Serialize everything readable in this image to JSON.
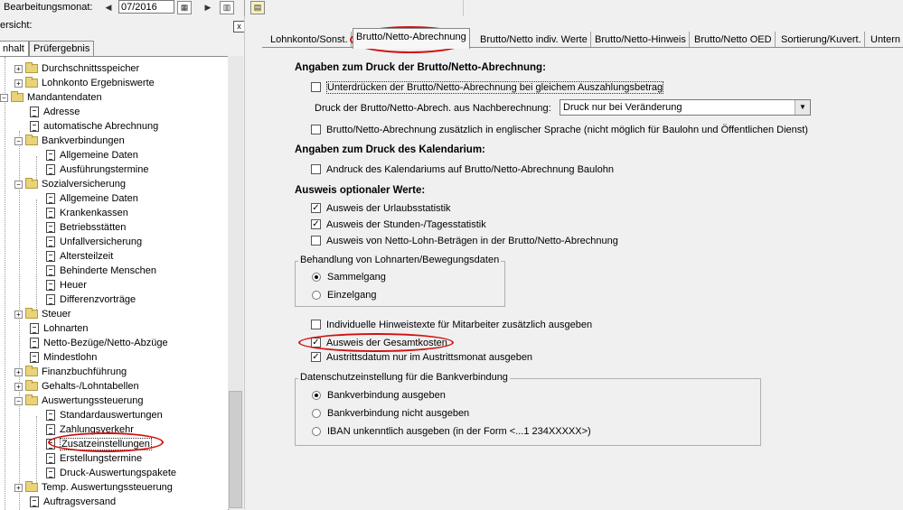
{
  "toolbar": {
    "label": "Bearbeitungsmonat:",
    "month": "07/2016"
  },
  "left_panel": {
    "header": "ersicht:",
    "close": "x",
    "tabs": [
      "nhalt",
      "Prüfergebnis"
    ],
    "tree": [
      {
        "label": "Durchschnittsspeicher",
        "type": "folder",
        "level": 1,
        "expander": "+"
      },
      {
        "label": "Lohnkonto Ergebniswerte",
        "type": "folder",
        "level": 1,
        "expander": "+"
      },
      {
        "label": "Mandantendaten",
        "type": "folder-open",
        "level": 0,
        "expander": "-"
      },
      {
        "label": "Adresse",
        "type": "doc",
        "level": 1
      },
      {
        "label": "automatische Abrechnung",
        "type": "doc",
        "level": 1
      },
      {
        "label": "Bankverbindungen",
        "type": "folder-open",
        "level": 1,
        "expander": "-"
      },
      {
        "label": "Allgemeine Daten",
        "type": "doc",
        "level": 2
      },
      {
        "label": "Ausführungstermine",
        "type": "doc",
        "level": 2
      },
      {
        "label": "Sozialversicherung",
        "type": "folder-open",
        "level": 1,
        "expander": "-"
      },
      {
        "label": "Allgemeine Daten",
        "type": "doc",
        "level": 2
      },
      {
        "label": "Krankenkassen",
        "type": "doc",
        "level": 2
      },
      {
        "label": "Betriebsstätten",
        "type": "doc",
        "level": 2
      },
      {
        "label": "Unfallversicherung",
        "type": "doc",
        "level": 2
      },
      {
        "label": "Altersteilzeit",
        "type": "doc",
        "level": 2
      },
      {
        "label": "Behinderte Menschen",
        "type": "doc",
        "level": 2
      },
      {
        "label": "Heuer",
        "type": "doc",
        "level": 2
      },
      {
        "label": "Differenzvorträge",
        "type": "doc",
        "level": 2
      },
      {
        "label": "Steuer",
        "type": "folder",
        "level": 1,
        "expander": "+"
      },
      {
        "label": "Lohnarten",
        "type": "doc",
        "level": 1
      },
      {
        "label": "Netto-Bezüge/Netto-Abzüge",
        "type": "doc",
        "level": 1
      },
      {
        "label": "Mindestlohn",
        "type": "doc",
        "level": 1
      },
      {
        "label": "Finanzbuchführung",
        "type": "folder",
        "level": 1,
        "expander": "+"
      },
      {
        "label": "Gehalts-/Lohntabellen",
        "type": "folder",
        "level": 1,
        "expander": "+"
      },
      {
        "label": "Auswertungssteuerung",
        "type": "folder-open",
        "level": 1,
        "expander": "-"
      },
      {
        "label": "Standardauswertungen",
        "type": "doc",
        "level": 2
      },
      {
        "label": "Zahlungsverkehr",
        "type": "doc",
        "level": 2
      },
      {
        "label": "Zusatzeinstellungen",
        "type": "doc",
        "level": 2
      },
      {
        "label": "Erstellungstermine",
        "type": "doc",
        "level": 2
      },
      {
        "label": "Druck-Auswertungspakete",
        "type": "doc",
        "level": 2
      },
      {
        "label": "Temp. Auswertungssteuerung",
        "type": "folder",
        "level": 1,
        "expander": "+"
      },
      {
        "label": "Auftragsversand",
        "type": "doc",
        "level": 1
      }
    ]
  },
  "tabs": [
    "Lohnkonto/Sonst.",
    "Brutto/Netto-Abrechnung",
    "Brutto/Netto indiv. Werte",
    "Brutto/Netto-Hinweis",
    "Brutto/Netto OED",
    "Sortierung/Kuvert.",
    "Untern"
  ],
  "form": {
    "sec1_title": "Angaben zum Druck der Brutto/Netto-Abrechnung:",
    "cb_unterdruecken": "Unterdrücken der Brutto/Netto-Abrechnung bei gleichem Auszahlungsbetrag",
    "nachberechnung_label": "Druck der Brutto/Netto-Abrech. aus Nachberechnung:",
    "nachberechnung_value": "Druck nur bei Veränderung",
    "cb_englisch": "Brutto/Netto-Abrechnung zusätzlich in englischer Sprache (nicht möglich für Baulohn und Öffentlichen Dienst)",
    "sec2_title": "Angaben zum Druck des Kalendarium:",
    "cb_kalendarium": "Andruck des Kalendariums auf Brutto/Netto-Abrechnung Baulohn",
    "sec3_title": "Ausweis optionaler Werte:",
    "cb_urlaub": "Ausweis der Urlaubsstatistik",
    "cb_stunden": "Ausweis der Stunden-/Tagesstatistik",
    "cb_netto_lohn": "Ausweis von Netto-Lohn-Beträgen in der Brutto/Netto-Abrechnung",
    "grp_lohnarten_title": "Behandlung von Lohnarten/Bewegungsdaten",
    "rb_sammelgang": "Sammelgang",
    "rb_einzelgang": "Einzelgang",
    "cb_hinweistexte": "Individuelle Hinweistexte für Mitarbeiter zusätzlich ausgeben",
    "cb_gesamtkosten": "Ausweis der Gesamtkosten",
    "cb_austritt": "Austrittsdatum nur im Austrittsmonat ausgeben",
    "grp_datenschutz_title": "Datenschutzeinstellung für die Bankverbindung",
    "rb_bank_aus": "Bankverbindung ausgeben",
    "rb_bank_nicht": "Bankverbindung nicht ausgeben",
    "rb_iban": "IBAN unkenntlich ausgeben (in der Form <...1 234XXXXX>)",
    "check_mark": "✓"
  },
  "colors": {
    "annotation": "#d01010",
    "folder": "#e8d37a"
  }
}
